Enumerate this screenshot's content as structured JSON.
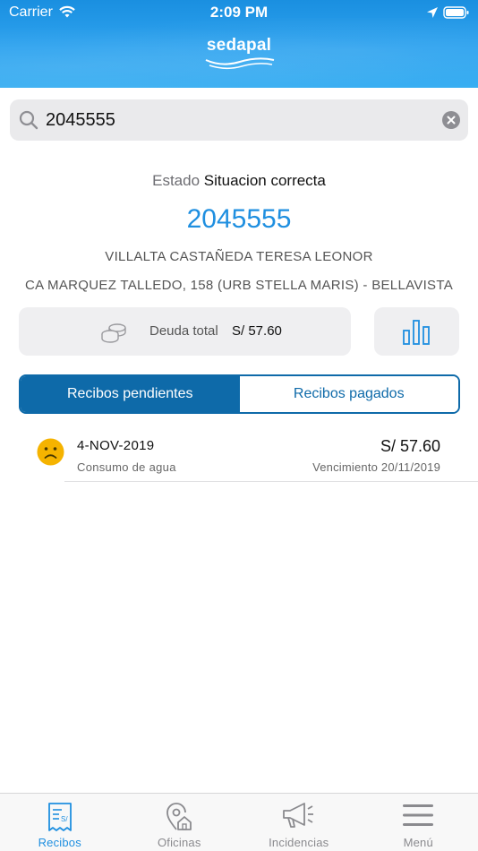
{
  "status_bar": {
    "carrier": "Carrier",
    "time": "2:09 PM"
  },
  "brand": {
    "name": "sedapal"
  },
  "search": {
    "value": "2045555",
    "placeholder": ""
  },
  "account": {
    "estado_label": "Estado",
    "estado_value": "Situacion correcta",
    "number": "2045555",
    "name": "VILLALTA CASTAÑEDA TERESA LEONOR",
    "address": "CA MARQUEZ TALLEDO, 158 (URB STELLA MARIS) - BELLAVISTA"
  },
  "debt": {
    "label": "Deuda total",
    "value": "S/ 57.60"
  },
  "tabs_segment": {
    "pending": "Recibos pendientes",
    "paid": "Recibos pagados"
  },
  "receipts": [
    {
      "date": "4-NOV-2019",
      "description": "Consumo de agua",
      "amount": "S/ 57.60",
      "due": "Vencimiento 20/11/2019"
    }
  ],
  "tab_bar": {
    "items": [
      {
        "label": "Recibos",
        "icon": "receipt-icon",
        "active": true
      },
      {
        "label": "Oficinas",
        "icon": "office-location-icon",
        "active": false
      },
      {
        "label": "Incidencias",
        "icon": "megaphone-icon",
        "active": false
      },
      {
        "label": "Menú",
        "icon": "hamburger-menu-icon",
        "active": false
      }
    ]
  },
  "colors": {
    "primary": "#1f8fe0",
    "segment_active": "#0e6aa9",
    "sad_face": "#f5b300",
    "header": "#2ea3ef"
  }
}
